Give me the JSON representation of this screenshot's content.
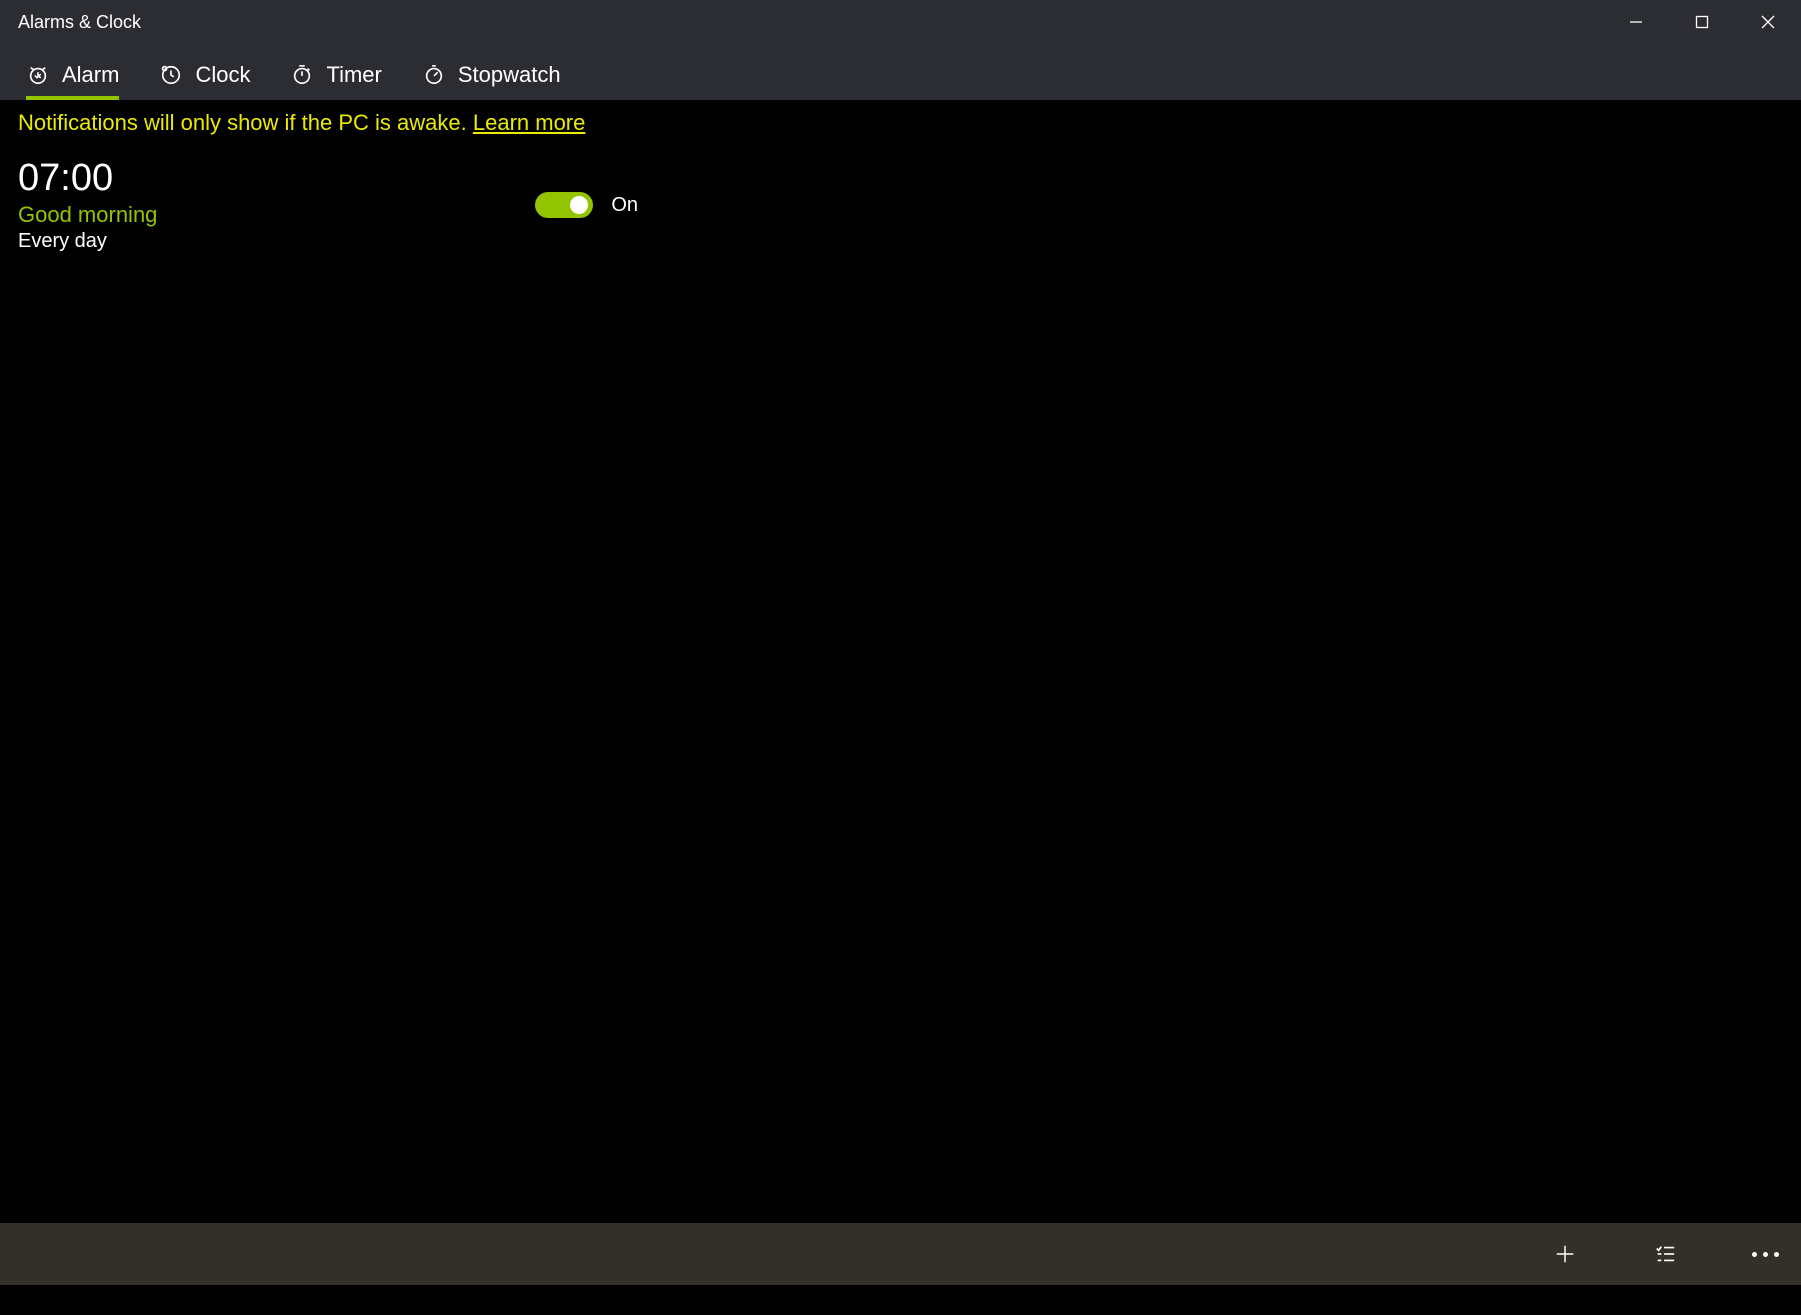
{
  "window": {
    "title": "Alarms & Clock"
  },
  "tabs": {
    "alarm": {
      "label": "Alarm"
    },
    "clock": {
      "label": "Clock"
    },
    "timer": {
      "label": "Timer"
    },
    "stopwatch": {
      "label": "Stopwatch"
    }
  },
  "notification": {
    "text": "Notifications will only show if the PC is awake. ",
    "link": "Learn more"
  },
  "alarms": [
    {
      "time": "07:00",
      "name": "Good morning",
      "repeat": "Every day",
      "state": "On"
    }
  ],
  "colors": {
    "accent": "#93c400",
    "notif": "#eaeb00"
  }
}
